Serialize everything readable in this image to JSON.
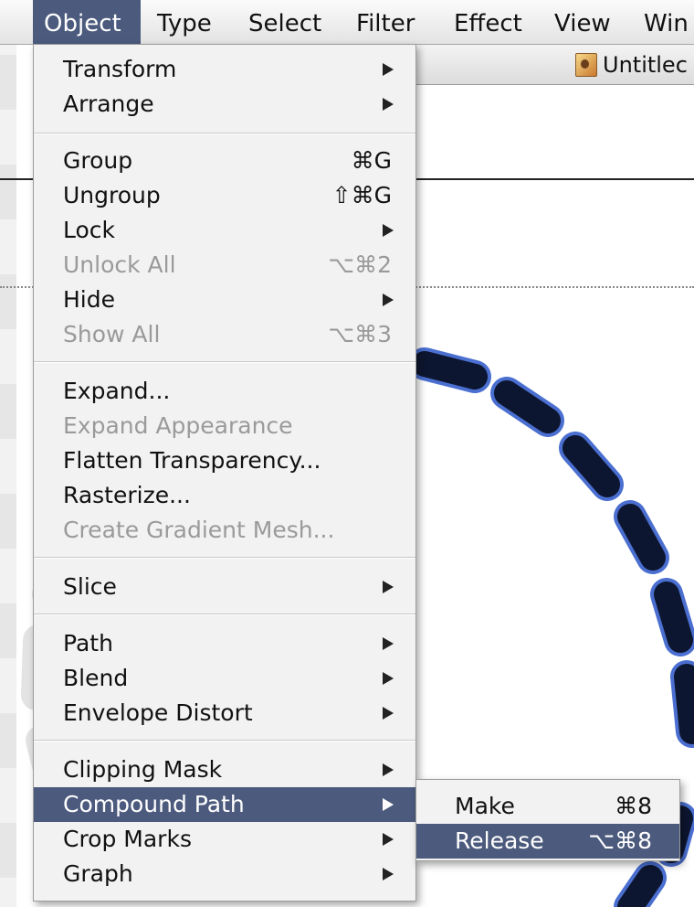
{
  "menubar": {
    "items": [
      {
        "label": "Object",
        "active": true
      },
      {
        "label": "Type"
      },
      {
        "label": "Select"
      },
      {
        "label": "Filter"
      },
      {
        "label": "Effect"
      },
      {
        "label": "View"
      },
      {
        "label": "Win"
      }
    ]
  },
  "document": {
    "title": "Untitlec",
    "icon": "illustrator-document-icon"
  },
  "object_menu": {
    "items": [
      {
        "label": "Transform",
        "submenu": true
      },
      {
        "label": "Arrange",
        "submenu": true
      },
      {
        "label": "Group",
        "shortcut": "⌘G"
      },
      {
        "label": "Ungroup",
        "shortcut": "⇧⌘G"
      },
      {
        "label": "Lock",
        "submenu": true
      },
      {
        "label": "Unlock All",
        "shortcut": "⌥⌘2",
        "disabled": true
      },
      {
        "label": "Hide",
        "submenu": true
      },
      {
        "label": "Show All",
        "shortcut": "⌥⌘3",
        "disabled": true
      },
      {
        "label": "Expand..."
      },
      {
        "label": "Expand Appearance",
        "disabled": true
      },
      {
        "label": "Flatten Transparency..."
      },
      {
        "label": "Rasterize..."
      },
      {
        "label": "Create Gradient Mesh...",
        "disabled": true
      },
      {
        "label": "Slice",
        "submenu": true
      },
      {
        "label": "Path",
        "submenu": true
      },
      {
        "label": "Blend",
        "submenu": true
      },
      {
        "label": "Envelope Distort",
        "submenu": true
      },
      {
        "label": "Clipping Mask",
        "submenu": true
      },
      {
        "label": "Compound Path",
        "submenu": true,
        "selected": true
      },
      {
        "label": "Crop Marks",
        "submenu": true
      },
      {
        "label": "Graph",
        "submenu": true
      }
    ]
  },
  "compound_path_submenu": {
    "items": [
      {
        "label": "Make",
        "shortcut": "⌘8"
      },
      {
        "label": "Release",
        "shortcut": "⌥⌘8",
        "selected": true
      }
    ]
  },
  "colors": {
    "highlight": "#4b5a7d",
    "menu_bg": "#f2f2f2",
    "disabled_text": "#9a9a9a",
    "stroke_dark": "#0d1630",
    "selection_outline": "#4a6fd0"
  }
}
